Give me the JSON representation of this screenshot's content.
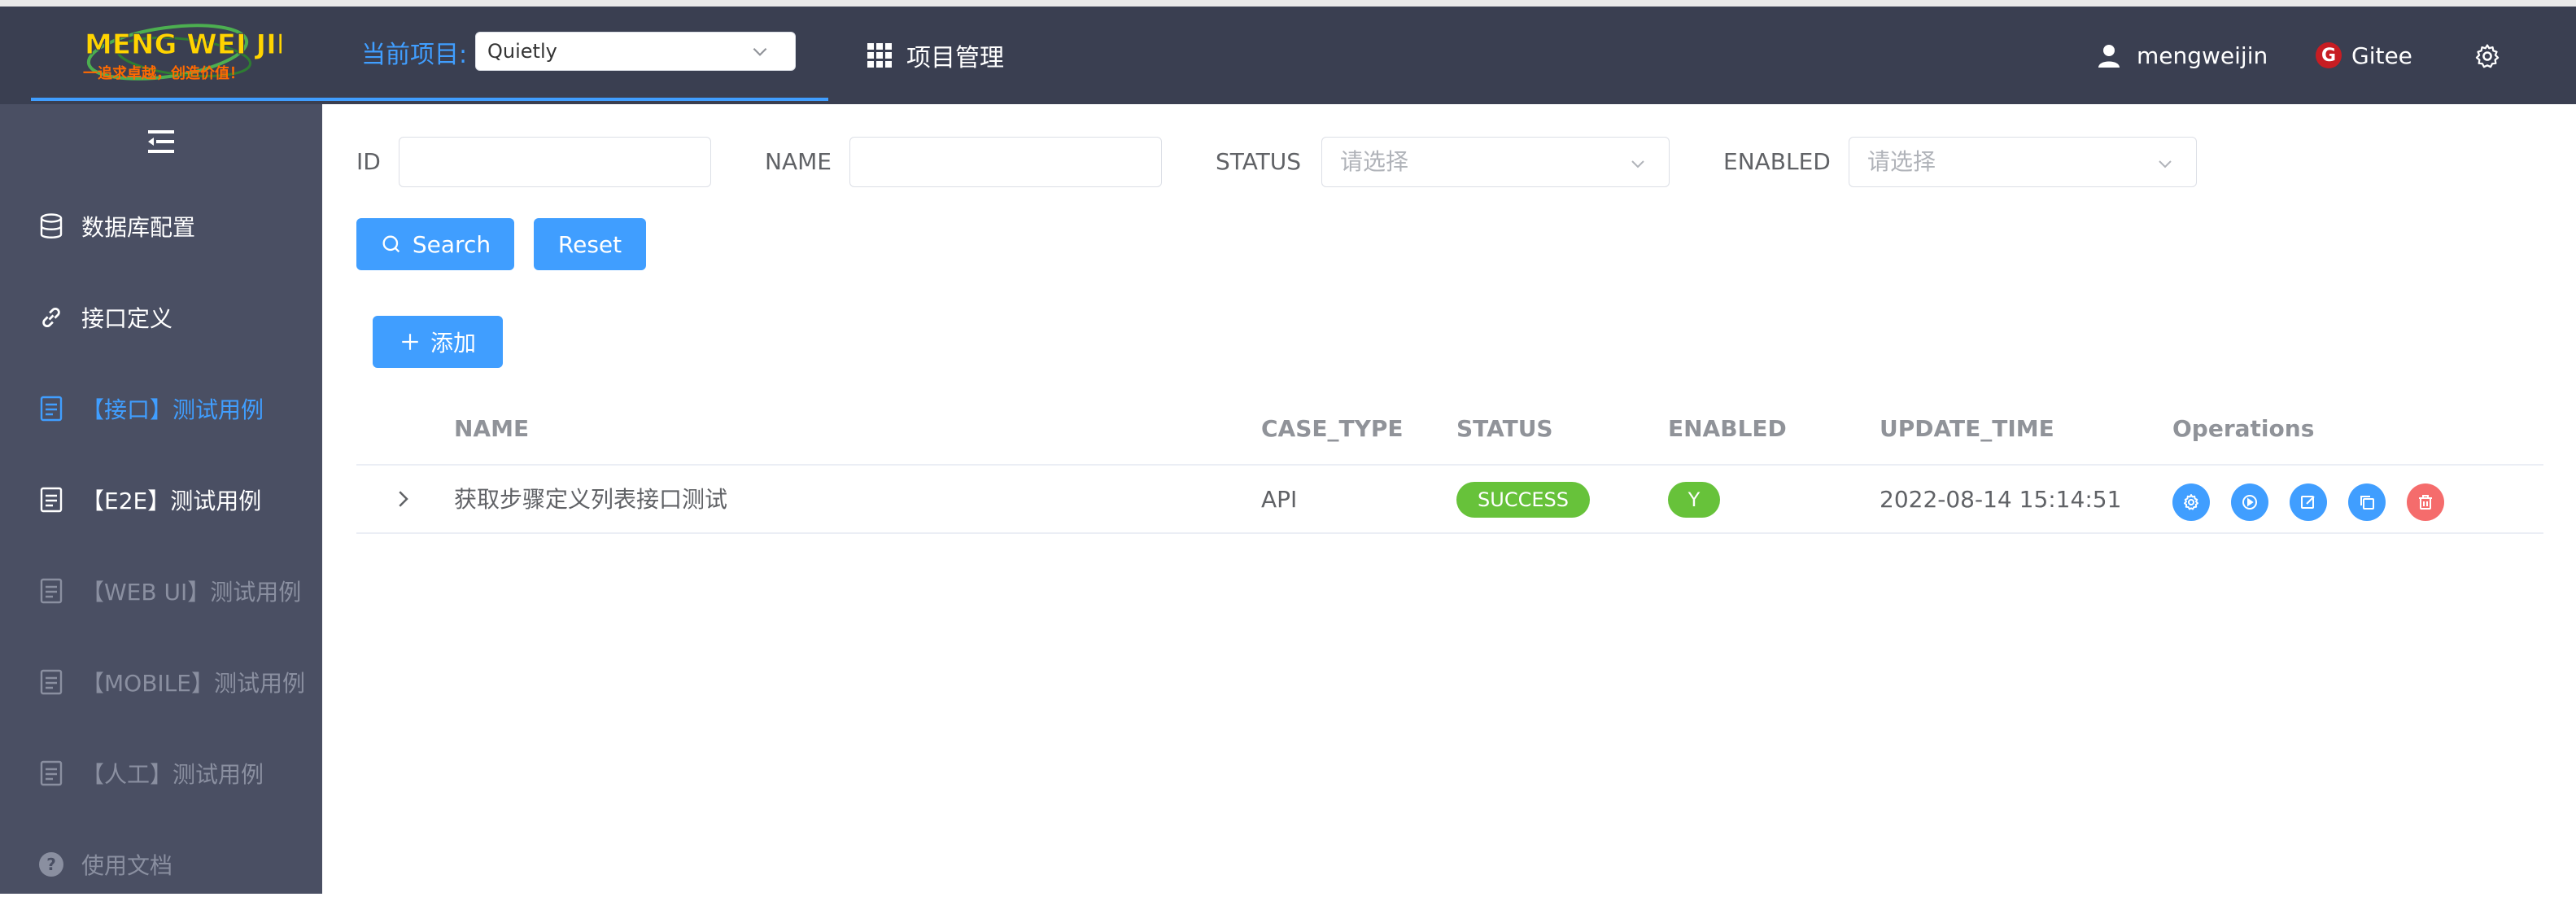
{
  "header": {
    "logo": {
      "title": "MENG WEI JIN",
      "slogan": "一追求卓越，创造价值！"
    },
    "project_label": "当前项目:",
    "project_value": "Quietly",
    "project_management": "项目管理",
    "username": "mengweijin",
    "gitee": "Gitee"
  },
  "sidebar": {
    "items": [
      {
        "label": "数据库配置",
        "state": "normal"
      },
      {
        "label": "接口定义",
        "state": "normal"
      },
      {
        "label": "【接口】测试用例",
        "state": "active"
      },
      {
        "label": "【E2E】测试用例",
        "state": "normal"
      },
      {
        "label": "【WEB UI】测试用例",
        "state": "disabled"
      },
      {
        "label": "【MOBILE】测试用例",
        "state": "disabled"
      },
      {
        "label": "【人工】测试用例",
        "state": "disabled"
      },
      {
        "label": "使用文档",
        "state": "disabled"
      }
    ]
  },
  "filters": {
    "id_label": "ID",
    "name_label": "NAME",
    "status_label": "STATUS",
    "status_placeholder": "请选择",
    "enabled_label": "ENABLED",
    "enabled_placeholder": "请选择",
    "search_button": "Search",
    "reset_button": "Reset"
  },
  "toolbar": {
    "add_button": "添加"
  },
  "table": {
    "columns": [
      "NAME",
      "CASE_TYPE",
      "STATUS",
      "ENABLED",
      "UPDATE_TIME",
      "Operations"
    ],
    "rows": [
      {
        "name": "获取步骤定义列表接口测试",
        "case_type": "API",
        "status": "SUCCESS",
        "enabled": "Y",
        "update_time": "2022-08-14 15:14:51",
        "operations": [
          "settings-icon",
          "play-icon",
          "edit-icon",
          "copy-icon",
          "delete-icon"
        ]
      }
    ]
  },
  "colors": {
    "primary": "#409eff",
    "success": "#67c23a",
    "danger": "#f56c6c",
    "header_bg": "#3a3f51",
    "sidebar_bg": "#4a4f63"
  }
}
